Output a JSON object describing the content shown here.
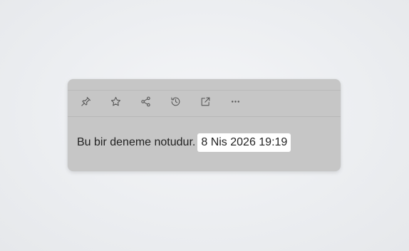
{
  "note": {
    "text": "Bu bir deneme notudur.",
    "timestamp": "8 Nis 2026 19:19"
  },
  "toolbar": {
    "buttons": [
      {
        "icon": "pin-icon"
      },
      {
        "icon": "star-icon"
      },
      {
        "icon": "share-icon"
      },
      {
        "icon": "history-icon"
      },
      {
        "icon": "external-link-icon"
      },
      {
        "icon": "more-icon"
      }
    ]
  },
  "colors": {
    "card_background": "#c6c6c6",
    "page_background": "#eceef1",
    "stamp_background": "#ffffff",
    "icon": "#555555",
    "text": "#222222"
  }
}
